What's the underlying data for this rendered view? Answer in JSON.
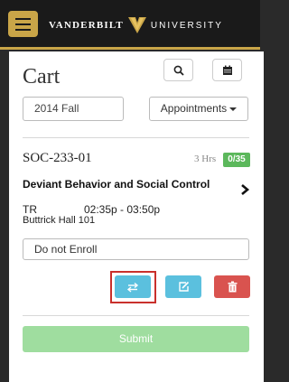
{
  "header": {
    "brand_left": "VANDERBILT",
    "brand_right": "UNIVERSITY",
    "menu_icon": "hamburger-icon",
    "logo_icon": "vanderbilt-v-logo"
  },
  "cart": {
    "title": "Cart",
    "search_icon": "search-icon",
    "calendar_icon": "calendar-icon",
    "term": "2014 Fall",
    "appointments_label": "Appointments"
  },
  "course": {
    "id": "SOC-233-01",
    "hours": "3 Hrs",
    "seats": "0/35",
    "name": "Deviant Behavior and Social Control",
    "days": "TR",
    "time": "02:35p - 03:50p",
    "room": "Buttrick Hall 101",
    "enroll_option": "Do not Enroll"
  },
  "actions": {
    "swap_icon": "swap-arrows-icon",
    "edit_icon": "edit-icon",
    "delete_icon": "trash-icon"
  },
  "submit_label": "Submit",
  "colors": {
    "gold": "#c9a548",
    "info": "#5bc0de",
    "danger": "#d9534f",
    "success": "#5cb85c",
    "submit_disabled": "#9fdd9f",
    "highlight": "#c9302c"
  }
}
